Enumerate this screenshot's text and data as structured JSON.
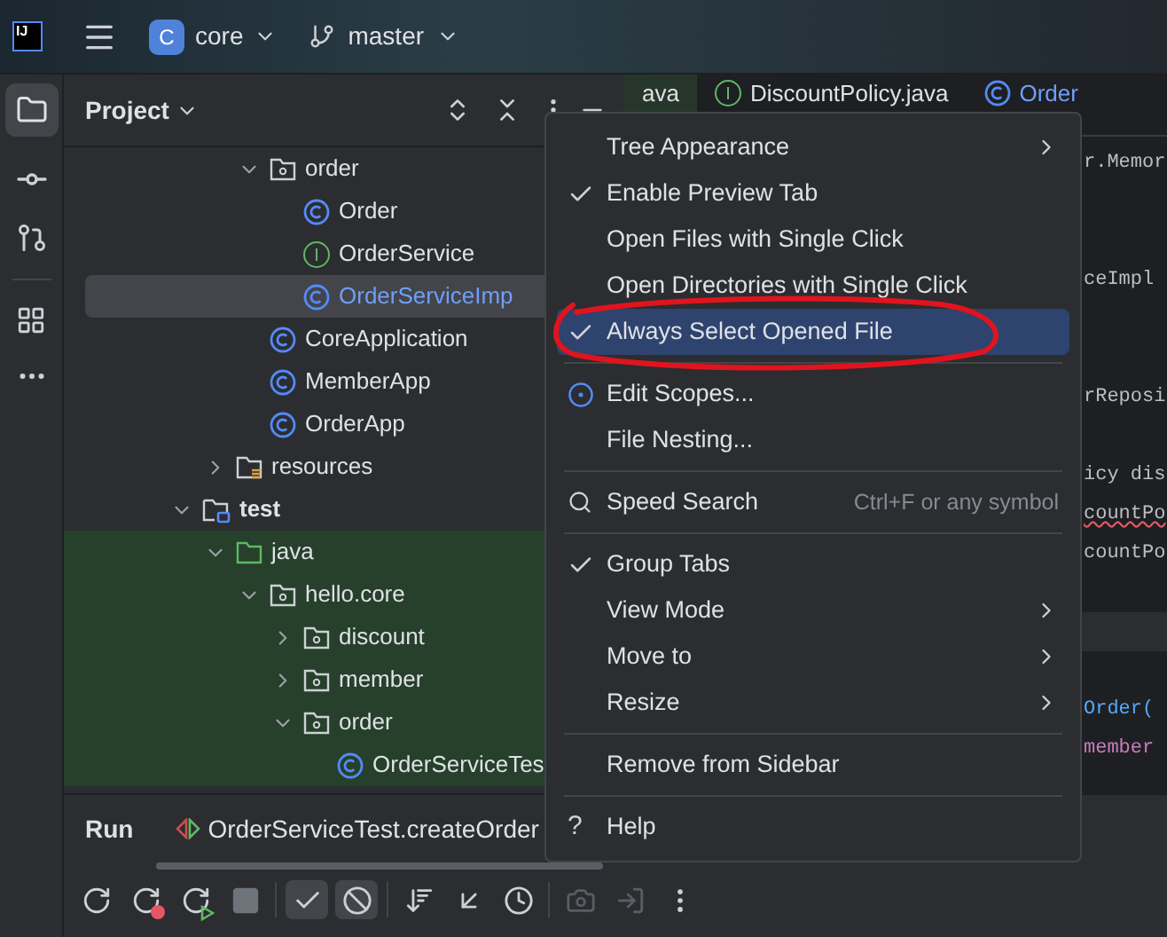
{
  "header": {
    "logo": "IJ",
    "project_badge": "C",
    "project": "core",
    "branch": "master"
  },
  "project_panel": {
    "title": "Project",
    "tree": [
      {
        "children": [
          {
            "children": [
              {
                "label": "order",
                "kind": "package",
                "expanded": true,
                "selected": false,
                "tinted": false,
                "children": [
                  {
                    "label": "Order",
                    "kind": "class",
                    "selected": false,
                    "tinted": false
                  },
                  {
                    "label": "OrderService",
                    "kind": "interface",
                    "selected": false,
                    "tinted": false
                  },
                  {
                    "label": "OrderServiceImp",
                    "kind": "class",
                    "selected": true,
                    "tinted": false
                  }
                ]
              },
              {
                "label": "CoreApplication",
                "kind": "class",
                "selected": false,
                "tinted": false
              },
              {
                "label": "MemberApp",
                "kind": "class",
                "selected": false,
                "tinted": false
              },
              {
                "label": "OrderApp",
                "kind": "class",
                "selected": false,
                "tinted": false
              }
            ]
          },
          {
            "label": "resources",
            "kind": "resources",
            "expanded": false,
            "selected": false,
            "tinted": false
          }
        ]
      },
      {
        "label": "test",
        "kind": "test-root",
        "expanded": true,
        "selected": false,
        "tinted": false,
        "children": [
          {
            "label": "java",
            "kind": "source-root",
            "expanded": true,
            "selected": false,
            "tinted": true,
            "children": [
              {
                "label": "hello.core",
                "kind": "package",
                "expanded": true,
                "selected": false,
                "tinted": true,
                "children": [
                  {
                    "label": "discount",
                    "kind": "package",
                    "expanded": false,
                    "selected": false,
                    "tinted": true
                  },
                  {
                    "label": "member",
                    "kind": "package",
                    "expanded": false,
                    "selected": false,
                    "tinted": true
                  },
                  {
                    "label": "order",
                    "kind": "package",
                    "expanded": true,
                    "selected": false,
                    "tinted": true,
                    "children": [
                      {
                        "label": "OrderServiceTes",
                        "kind": "class",
                        "selected": false,
                        "tinted": true
                      }
                    ]
                  }
                ]
              }
            ]
          }
        ]
      }
    ]
  },
  "editor": {
    "tabs": [
      {
        "label": "ava",
        "kind": "plain",
        "selected": false
      },
      {
        "label": "DiscountPolicy.java",
        "kind": "interface",
        "selected": false
      },
      {
        "label": "Order",
        "kind": "class",
        "selected": true
      }
    ],
    "lines": [
      {
        "text": "r.Memor",
        "kind": "code"
      },
      {
        "kind": "blank"
      },
      {
        "kind": "blank"
      },
      {
        "text": "ceImpl",
        "kind": "code"
      },
      {
        "kind": "blank"
      },
      {
        "kind": "blank"
      },
      {
        "text": "rReposi",
        "kind": "code"
      },
      {
        "kind": "blank"
      },
      {
        "text": "icy dis",
        "kind": "code"
      },
      {
        "text": "countPo",
        "kind": "error"
      },
      {
        "text": "countPo",
        "kind": "code"
      },
      {
        "kind": "blank"
      },
      {
        "kind": "break"
      },
      {
        "kind": "blank"
      },
      {
        "text": "Order(",
        "kind": "method"
      },
      {
        "text": "member",
        "kind": "field"
      }
    ]
  },
  "context_menu": {
    "items": [
      {
        "kind": "item",
        "label": "Tree Appearance",
        "checked": false,
        "selected": false,
        "submenu": true
      },
      {
        "kind": "item",
        "label": "Enable Preview Tab",
        "checked": true,
        "selected": false,
        "submenu": false
      },
      {
        "kind": "item",
        "label": "Open Files with Single Click",
        "checked": false,
        "selected": false,
        "submenu": false
      },
      {
        "kind": "item",
        "label": "Open Directories with Single Click",
        "checked": false,
        "selected": false,
        "submenu": false
      },
      {
        "kind": "item",
        "label": "Always Select Opened File",
        "checked": true,
        "selected": true,
        "submenu": false
      },
      {
        "kind": "separator"
      },
      {
        "kind": "scope",
        "label": "Edit Scopes...",
        "checked": false,
        "selected": false,
        "submenu": false
      },
      {
        "kind": "item",
        "label": "File Nesting...",
        "checked": false,
        "selected": false,
        "submenu": false
      },
      {
        "kind": "separator"
      },
      {
        "kind": "search",
        "label": "Speed Search",
        "shortcut": "Ctrl+F or any symbol",
        "checked": false,
        "selected": false,
        "submenu": false
      },
      {
        "kind": "separator"
      },
      {
        "kind": "item",
        "label": "Group Tabs",
        "checked": true,
        "selected": false,
        "submenu": false
      },
      {
        "kind": "item",
        "label": "View Mode",
        "checked": false,
        "selected": false,
        "submenu": true
      },
      {
        "kind": "item",
        "label": "Move to",
        "checked": false,
        "selected": false,
        "submenu": true
      },
      {
        "kind": "item",
        "label": "Resize",
        "checked": false,
        "selected": false,
        "submenu": true
      },
      {
        "kind": "separator"
      },
      {
        "kind": "item",
        "label": "Remove from Sidebar",
        "checked": false,
        "selected": false,
        "submenu": false
      },
      {
        "kind": "separator"
      },
      {
        "kind": "help",
        "label": "Help",
        "glyph": "?",
        "checked": false,
        "selected": false,
        "submenu": false
      }
    ]
  },
  "run_panel": {
    "title": "Run",
    "config": "OrderServiceTest.createOrder",
    "toolbar": [
      {
        "kind": "rerun",
        "on": false,
        "disabled": false
      },
      {
        "kind": "rerun-failed",
        "on": false,
        "disabled": false
      },
      {
        "kind": "toggle-rerun",
        "on": false,
        "disabled": false
      },
      {
        "kind": "stop",
        "on": false,
        "disabled": false
      },
      {
        "kind": "sep"
      },
      {
        "kind": "show-passed",
        "on": true,
        "disabled": false
      },
      {
        "kind": "show-ignored",
        "on": true,
        "disabled": false
      },
      {
        "kind": "sep"
      },
      {
        "kind": "sort",
        "on": false,
        "disabled": false
      },
      {
        "kind": "import",
        "on": false,
        "disabled": false
      },
      {
        "kind": "history",
        "on": false,
        "disabled": false
      },
      {
        "kind": "sep"
      },
      {
        "kind": "screenshot",
        "on": false,
        "disabled": true
      },
      {
        "kind": "export",
        "on": false,
        "disabled": true
      },
      {
        "kind": "more",
        "on": false,
        "disabled": false
      }
    ]
  }
}
